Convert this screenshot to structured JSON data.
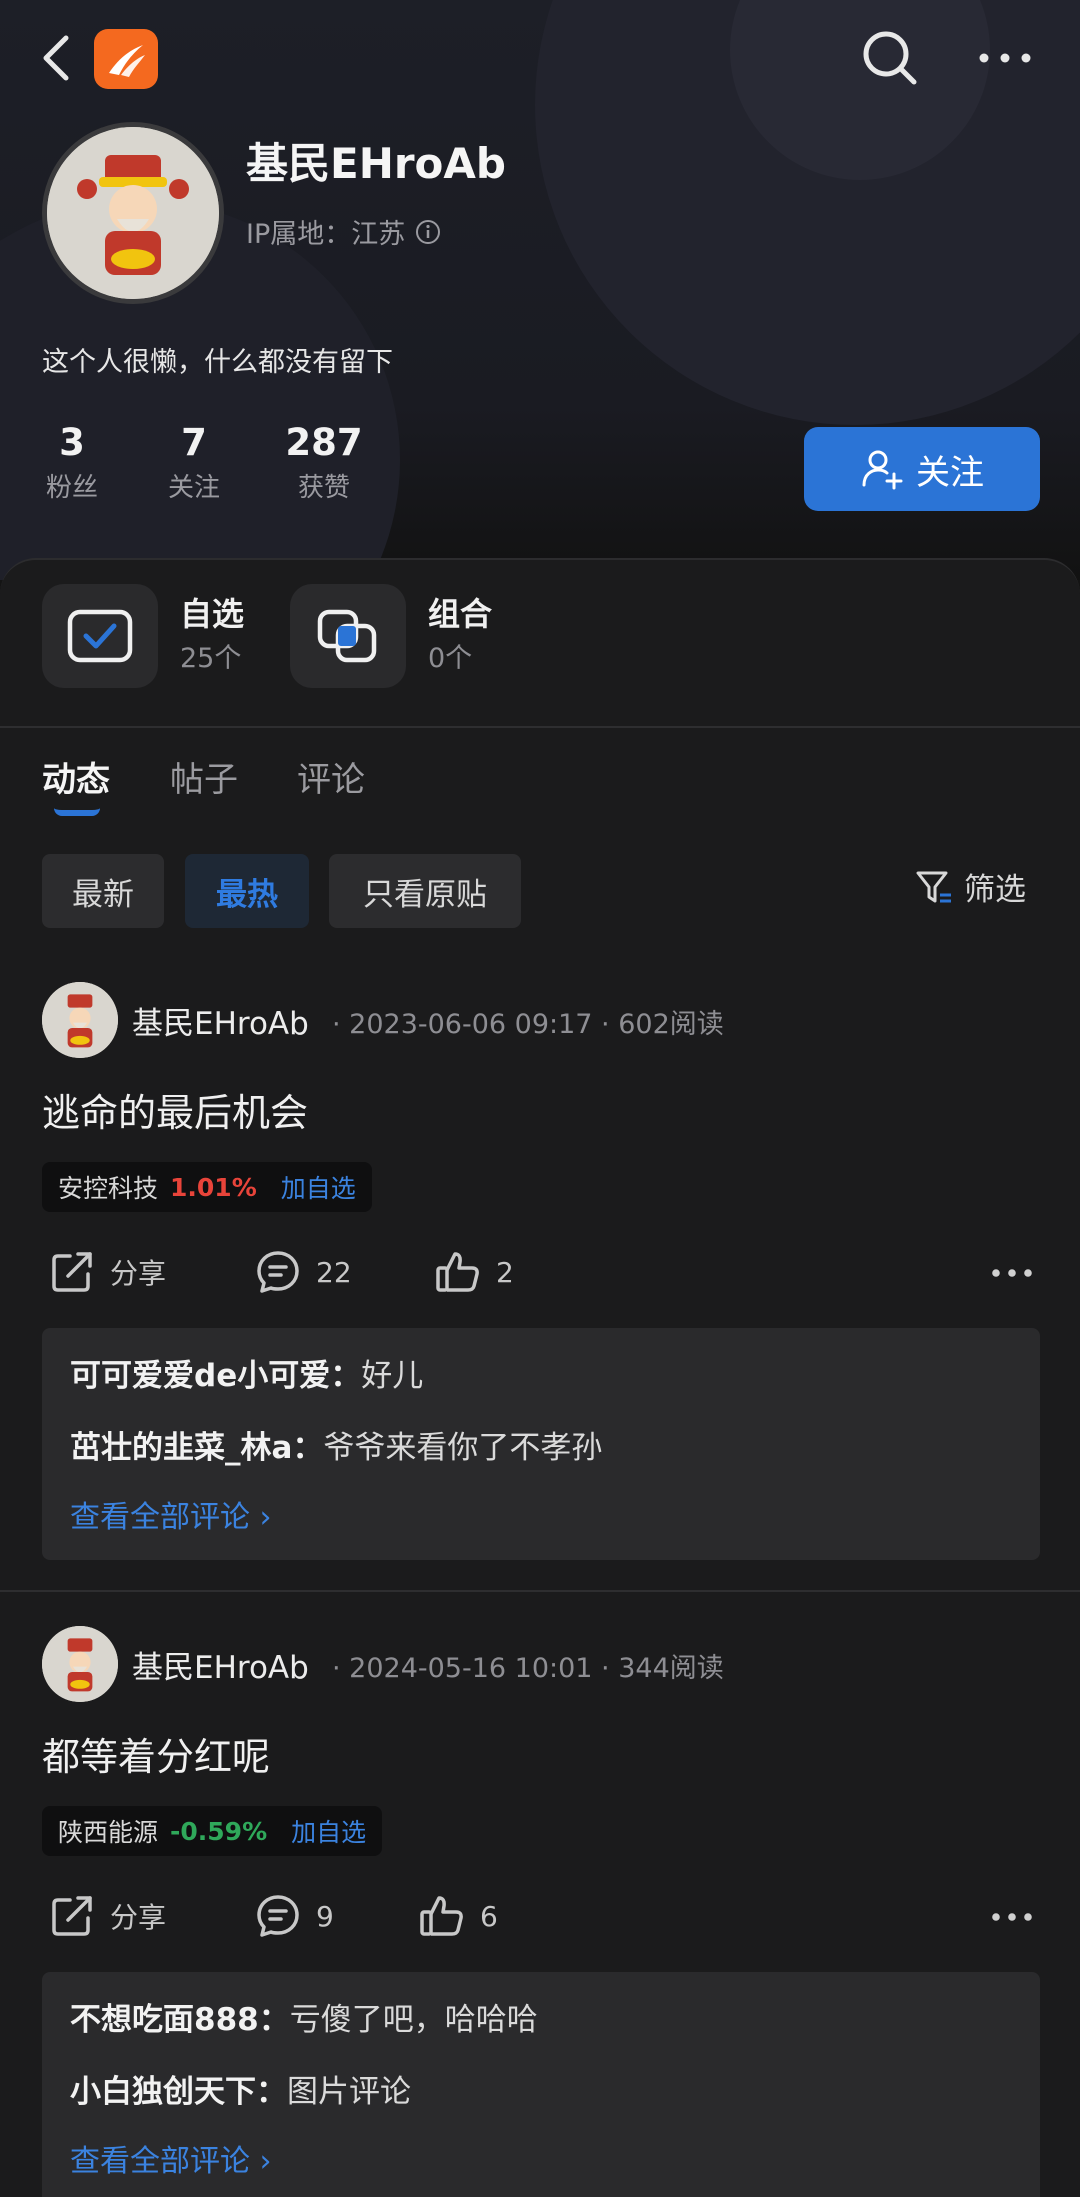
{
  "icons": {
    "back": "chevron-left-icon",
    "search": "search-icon",
    "more": "more-dots-icon",
    "info": "info-icon",
    "add_user": "add-user-icon",
    "watchlist": "checkbox-icon",
    "portfolio": "layers-icon",
    "filter": "filter-icon",
    "share": "share-icon",
    "comment": "comment-icon",
    "like": "thumbs-up-icon"
  },
  "colors": {
    "accent": "#2b74d6",
    "up": "#e8443a",
    "down": "#2fa85a",
    "logo": "#f4691f"
  },
  "profile": {
    "name": "基民EHroAb",
    "ip_location": "IP属地：江苏",
    "bio": "这个人很懒，什么都没有留下",
    "stats": [
      {
        "value": "3",
        "label": "粉丝"
      },
      {
        "value": "7",
        "label": "关注"
      },
      {
        "value": "287",
        "label": "获赞"
      }
    ],
    "follow_label": "关注"
  },
  "assets": [
    {
      "title": "自选",
      "count": "25个"
    },
    {
      "title": "组合",
      "count": "0个"
    }
  ],
  "tabs": [
    {
      "label": "动态"
    },
    {
      "label": "帖子"
    },
    {
      "label": "评论"
    }
  ],
  "filters": {
    "chips": [
      {
        "label": "最新"
      },
      {
        "label": "最热"
      },
      {
        "label": "只看原贴"
      }
    ],
    "filter_label": "筛选"
  },
  "posts": [
    {
      "author": "基民EHroAb",
      "meta": "· 2023-06-06 09:17 · 602阅读",
      "title": "逃命的最后机会",
      "stock": {
        "name": "安控科技",
        "change": "1.01%",
        "add_label": "加自选"
      },
      "share_label": "分享",
      "comments_count": "22",
      "likes_count": "2",
      "comments": [
        {
          "user": "可可爱爱de小可爱：",
          "text": "好儿"
        },
        {
          "user": "茁壮的韭菜_林a：",
          "text": "爷爷来看你了不孝孙"
        }
      ],
      "view_all": "查看全部评论 ›"
    },
    {
      "author": "基民EHroAb",
      "meta": "· 2024-05-16 10:01 · 344阅读",
      "title": "都等着分红呢",
      "stock": {
        "name": "陕西能源",
        "change": "-0.59%",
        "add_label": "加自选"
      },
      "share_label": "分享",
      "comments_count": "9",
      "likes_count": "6",
      "comments": [
        {
          "user": "不想吃面888：",
          "text": "亏傻了吧，哈哈哈"
        },
        {
          "user": "小白独创天下：",
          "text": "图片评论"
        }
      ],
      "view_all": "查看全部评论 ›"
    }
  ]
}
